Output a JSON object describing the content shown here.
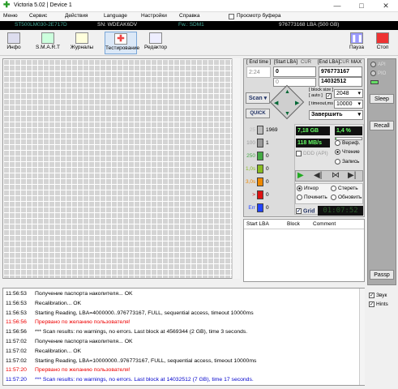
{
  "window": {
    "title": "Victoria 5.02 | Device 1",
    "min": "—",
    "max": "□",
    "close": "✕"
  },
  "menu": [
    "Меню",
    "Сервис",
    "Действия",
    "Language",
    "Настройки",
    "Справка"
  ],
  "menu_buffer": "Просмотр буфера",
  "info": {
    "model": "ST500LM030-2E717D",
    "serial": "SN: WDEAK6DV",
    "fw": "Fw.: SDM1",
    "lba": "976773168 LBA (500 GB)"
  },
  "toolbar": [
    "Инфо",
    "S.M.A.R.T",
    "Журналы",
    "Тестирование",
    "Редактор"
  ],
  "toolbar_right": {
    "pause": "Пауза",
    "stop": "Стоп"
  },
  "range": {
    "end_time_label": "[ End time ]",
    "start_lba_label": "[Start LBA]",
    "end_lba_label": "[End LBA]",
    "cur_label": "CUR",
    "max_label": "MAX",
    "time": "2:24",
    "start_lba": "0",
    "end_lba": "976773167",
    "cur_lba": "0",
    "pos_lba": "14032512"
  },
  "scan": {
    "scan_btn": "Scan",
    "quick_btn": "QUICK",
    "block_size_label": "[ block size ]",
    "auto_label": "[ auto ]",
    "block_size": "2048",
    "timeout_label": "[ timeout,ms ]",
    "timeout": "10000",
    "finish_select": "Завершить"
  },
  "stats": [
    {
      "label": "25",
      "value": "1969",
      "color": "#bbbbbb"
    },
    {
      "label": "100",
      "value": "1",
      "color": "#999999"
    },
    {
      "label": "250",
      "value": "0",
      "color": "#44aa44"
    },
    {
      "label": "1,0s",
      "value": "0",
      "color": "#88bb22"
    },
    {
      "label": "3,0s",
      "value": "0",
      "color": "#ee8800"
    },
    {
      "label": ">",
      "value": "0",
      "color": "#dd1111"
    },
    {
      "label": "Err",
      "value": "0",
      "color": "#2244ff"
    }
  ],
  "readouts": {
    "size": "7,18 GB",
    "percent": "1,4 %",
    "speed": "118 MB/s",
    "ddd": "DDD (API)"
  },
  "modes": {
    "verify": "Вериф.",
    "read": "Чтение",
    "write": "Запись"
  },
  "actions": {
    "ignore": "Игнор",
    "erase": "Стереть",
    "repair": "Починить",
    "refresh": "Обновить"
  },
  "grid_toggle": "Grid",
  "timer": "01:07:52",
  "table": {
    "cols": [
      "Start LBA",
      "Block",
      "Comment"
    ]
  },
  "side": {
    "api": "API",
    "pio": "PIO",
    "sleep": "Sleep",
    "recall": "Recall",
    "passp": "Passp"
  },
  "log": [
    {
      "time": "11:56:53",
      "text": "Получение паспорта накопителя... OK",
      "cls": ""
    },
    {
      "time": "11:56:53",
      "text": "Recalibration... OK",
      "cls": ""
    },
    {
      "time": "11:56:53",
      "text": "Starting Reading, LBA=4000000..976773167, FULL, sequential access, timeout 10000ms",
      "cls": ""
    },
    {
      "time": "11:56:56",
      "text": "Прервано по желанию пользователя!",
      "cls": "red"
    },
    {
      "time": "11:56:56",
      "text": "*** Scan results: no warnings, no errors. Last block at 4569344 (2 GB), time 3 seconds.",
      "cls": ""
    },
    {
      "time": "11:57:02",
      "text": "Получение паспорта накопителя... OK",
      "cls": ""
    },
    {
      "time": "11:57:02",
      "text": "Recalibration... OK",
      "cls": ""
    },
    {
      "time": "11:57:02",
      "text": "Starting Reading, LBA=10000000..976773167, FULL, sequential access, timeout 10000ms",
      "cls": ""
    },
    {
      "time": "11:57:20",
      "text": "Прервано по желанию пользователя!",
      "cls": "red"
    },
    {
      "time": "11:57:20",
      "text": "*** Scan results: no warnings, no errors. Last block at 14032512 (7 GB), time 17 seconds.",
      "cls": "blu"
    }
  ],
  "log_opts": {
    "sound": "Звук",
    "hints": "Hints"
  }
}
